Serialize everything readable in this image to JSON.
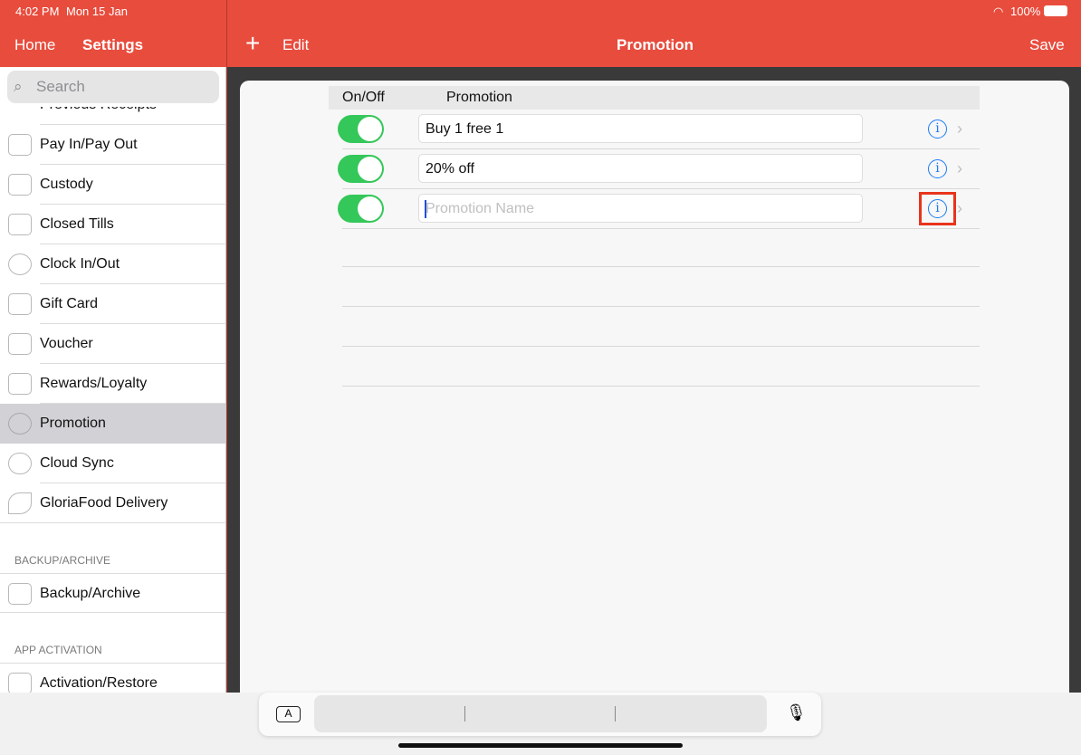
{
  "status": {
    "time": "4:02 PM",
    "date": "Mon 15 Jan",
    "battery": "100%"
  },
  "nav": {
    "home": "Home",
    "settings": "Settings",
    "add": "+",
    "edit": "Edit",
    "title": "Promotion",
    "save": "Save"
  },
  "sidebar": {
    "search_placeholder": "Search",
    "items": [
      "Previous Receipts",
      "Pay In/Pay Out",
      "Custody",
      "Closed Tills",
      "Clock In/Out",
      "Gift Card",
      "Voucher",
      "Rewards/Loyalty",
      "Promotion",
      "Cloud Sync",
      "GloriaFood Delivery"
    ],
    "selected": "Promotion",
    "section_backup": "BACKUP/ARCHIVE",
    "backup_item": "Backup/Archive",
    "section_activation": "APP ACTIVATION",
    "activation_item": "Activation/Restore"
  },
  "table": {
    "headers": [
      "On/Off",
      "Promotion"
    ],
    "rows": [
      {
        "on": true,
        "name": "Buy 1 free 1"
      },
      {
        "on": true,
        "name": "20% off"
      },
      {
        "on": true,
        "name": "",
        "placeholder": "Promotion Name"
      }
    ]
  },
  "keyboard": {
    "a_key": "A"
  },
  "colors": {
    "brand": "#e84c3d",
    "toggle_on": "#34c759",
    "info": "#1a7cf5",
    "highlight": "#e8341c"
  }
}
